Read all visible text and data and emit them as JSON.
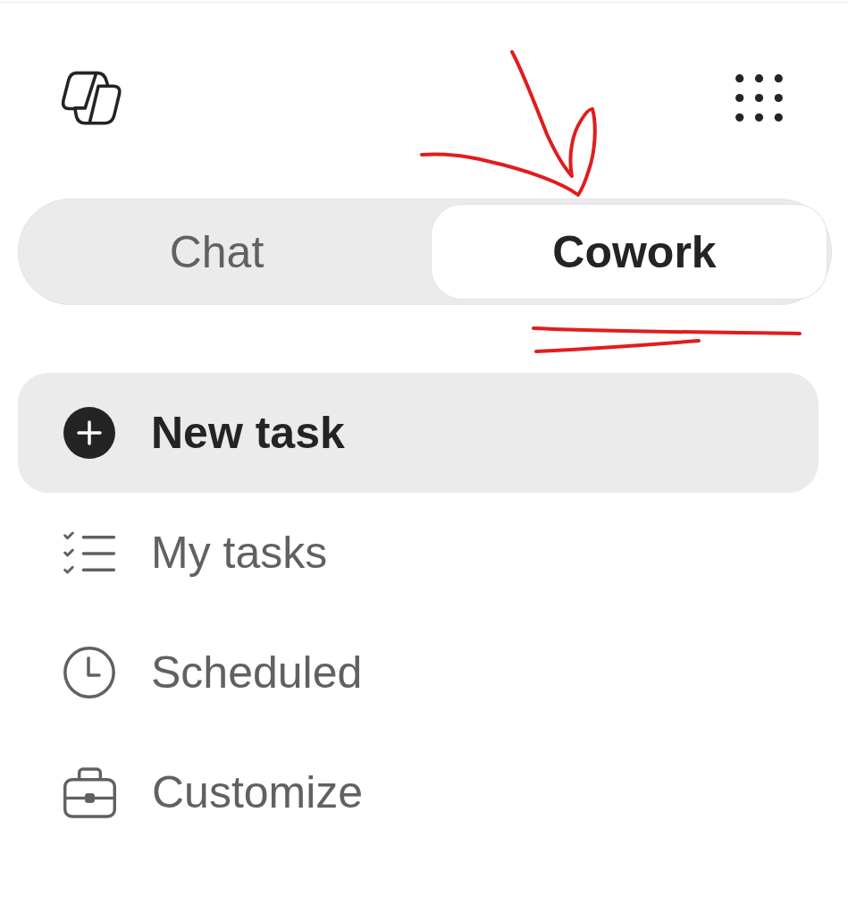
{
  "segmented_control": {
    "tabs": [
      {
        "label": "Chat",
        "selected": false
      },
      {
        "label": "Cowork",
        "selected": true
      }
    ]
  },
  "nav": {
    "items": [
      {
        "label": "New task",
        "selected": true
      },
      {
        "label": "My tasks",
        "selected": false
      },
      {
        "label": "Scheduled",
        "selected": false
      },
      {
        "label": "Customize",
        "selected": false
      }
    ]
  }
}
